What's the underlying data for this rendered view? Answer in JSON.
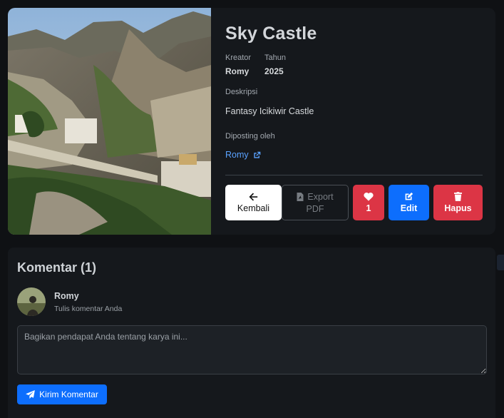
{
  "artwork": {
    "title": "Sky Castle",
    "creator_label": "Kreator",
    "creator": "Romy",
    "year_label": "Tahun",
    "year": "2025",
    "description_label": "Deskripsi",
    "description": "Fantasy Icikiwir Castle",
    "posted_by_label": "Diposting oleh",
    "posted_by": "Romy",
    "image_icon": "landscape-photo"
  },
  "actions": {
    "back_label": "Kembali",
    "export_label_line1": "Export",
    "export_label_line2": "PDF",
    "like_count": "1",
    "edit_label": "Edit",
    "delete_label": "Hapus"
  },
  "comments": {
    "title": "Komentar (1)",
    "user_name": "Romy",
    "hint": "Tulis komentar Anda",
    "placeholder": "Bagikan pendapat Anda tentang karya ini...",
    "submit_label": "Kirim Komentar"
  },
  "colors": {
    "background": "#0f1114",
    "card": "#15181c",
    "danger": "#dc3545",
    "primary": "#0d6efd",
    "link": "#5aa2ff"
  }
}
